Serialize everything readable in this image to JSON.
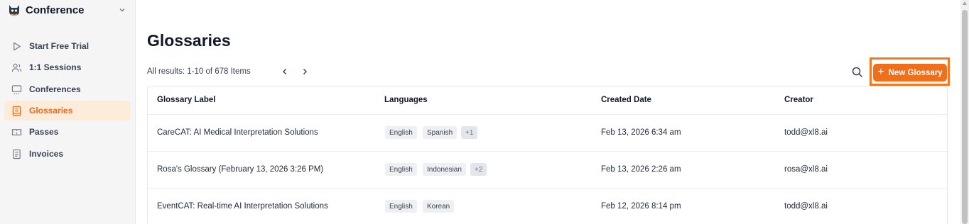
{
  "sidebar": {
    "workspace_name": "Conference",
    "items": [
      {
        "label": "Start Free Trial",
        "icon": "play-icon",
        "active": false
      },
      {
        "label": "1:1 Sessions",
        "icon": "users-icon",
        "active": false
      },
      {
        "label": "Conferences",
        "icon": "monitor-icon",
        "active": false
      },
      {
        "label": "Glossaries",
        "icon": "book-icon",
        "active": true
      },
      {
        "label": "Passes",
        "icon": "ticket-icon",
        "active": false
      },
      {
        "label": "Invoices",
        "icon": "document-icon",
        "active": false
      }
    ]
  },
  "main": {
    "title": "Glossaries",
    "results_text": "All results: 1-10 of 678 Items",
    "new_button_label": "New Glossary"
  },
  "table": {
    "columns": [
      "Glossary Label",
      "Languages",
      "Created Date",
      "Creator"
    ],
    "rows": [
      {
        "label": "CareCAT: AI Medical Interpretation Solutions",
        "languages": [
          "English",
          "Spanish"
        ],
        "more": "+1",
        "created": "Feb 13, 2026 6:34 am",
        "creator": "todd@xl8.ai"
      },
      {
        "label": "Rosa's Glossary (February 13, 2026 3:26 PM)",
        "languages": [
          "English",
          "Indonesian"
        ],
        "more": "+2",
        "created": "Feb 13, 2026 2:26 am",
        "creator": "rosa@xl8.ai"
      },
      {
        "label": "EventCAT: Real-time AI Interpretation Solutions",
        "languages": [
          "English",
          "Korean"
        ],
        "more": "",
        "created": "Feb 12, 2026 8:14 pm",
        "creator": "todd@xl8.ai"
      }
    ]
  },
  "colors": {
    "accent": "#ef6f1a",
    "active_bg": "#fdecd9"
  }
}
